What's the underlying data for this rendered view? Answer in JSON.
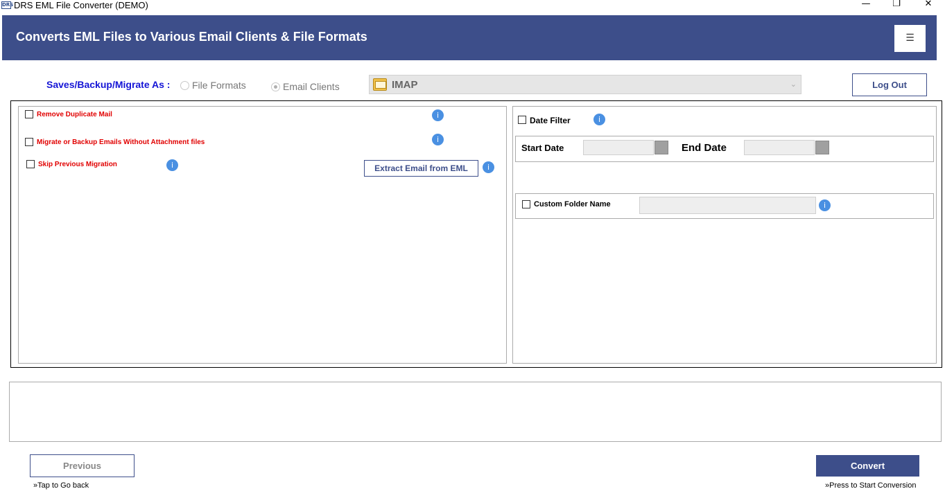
{
  "window": {
    "icon_text": "DRS",
    "title": "DRS EML File Converter (DEMO)",
    "minimize": "—",
    "restore": "❐",
    "close": "✕"
  },
  "header": {
    "title": "Converts EML Files to Various Email Clients & File Formats",
    "menu_icon": "☰"
  },
  "saves": {
    "label": "Saves/Backup/Migrate As :",
    "option_file_formats": "File Formats",
    "option_email_clients": "Email Clients",
    "selected": "Email Clients",
    "combo_value": "IMAP",
    "combo_arrow": "⌄",
    "logout_label": "Log Out"
  },
  "left_options": {
    "remove_duplicate": "Remove Duplicate Mail",
    "without_attachment": "Migrate or Backup Emails Without Attachment files",
    "skip_previous": "Skip Previous Migration",
    "extract_button": "Extract Email from EML",
    "info_glyph": "i"
  },
  "right_options": {
    "date_filter": "Date Filter",
    "start_date_label": "Start Date",
    "end_date_label": "End Date",
    "start_date_value": "",
    "end_date_value": "",
    "custom_folder": "Custom Folder Name",
    "custom_folder_value": ""
  },
  "footer": {
    "previous_label": "Previous",
    "previous_hint": "»Tap to Go back",
    "convert_label": "Convert",
    "convert_hint": "»Press to Start Conversion"
  },
  "colors": {
    "accent": "#3d4e8a",
    "option_red": "#e10000",
    "saves_blue": "#1414d6",
    "info_blue": "#4a90e2"
  }
}
